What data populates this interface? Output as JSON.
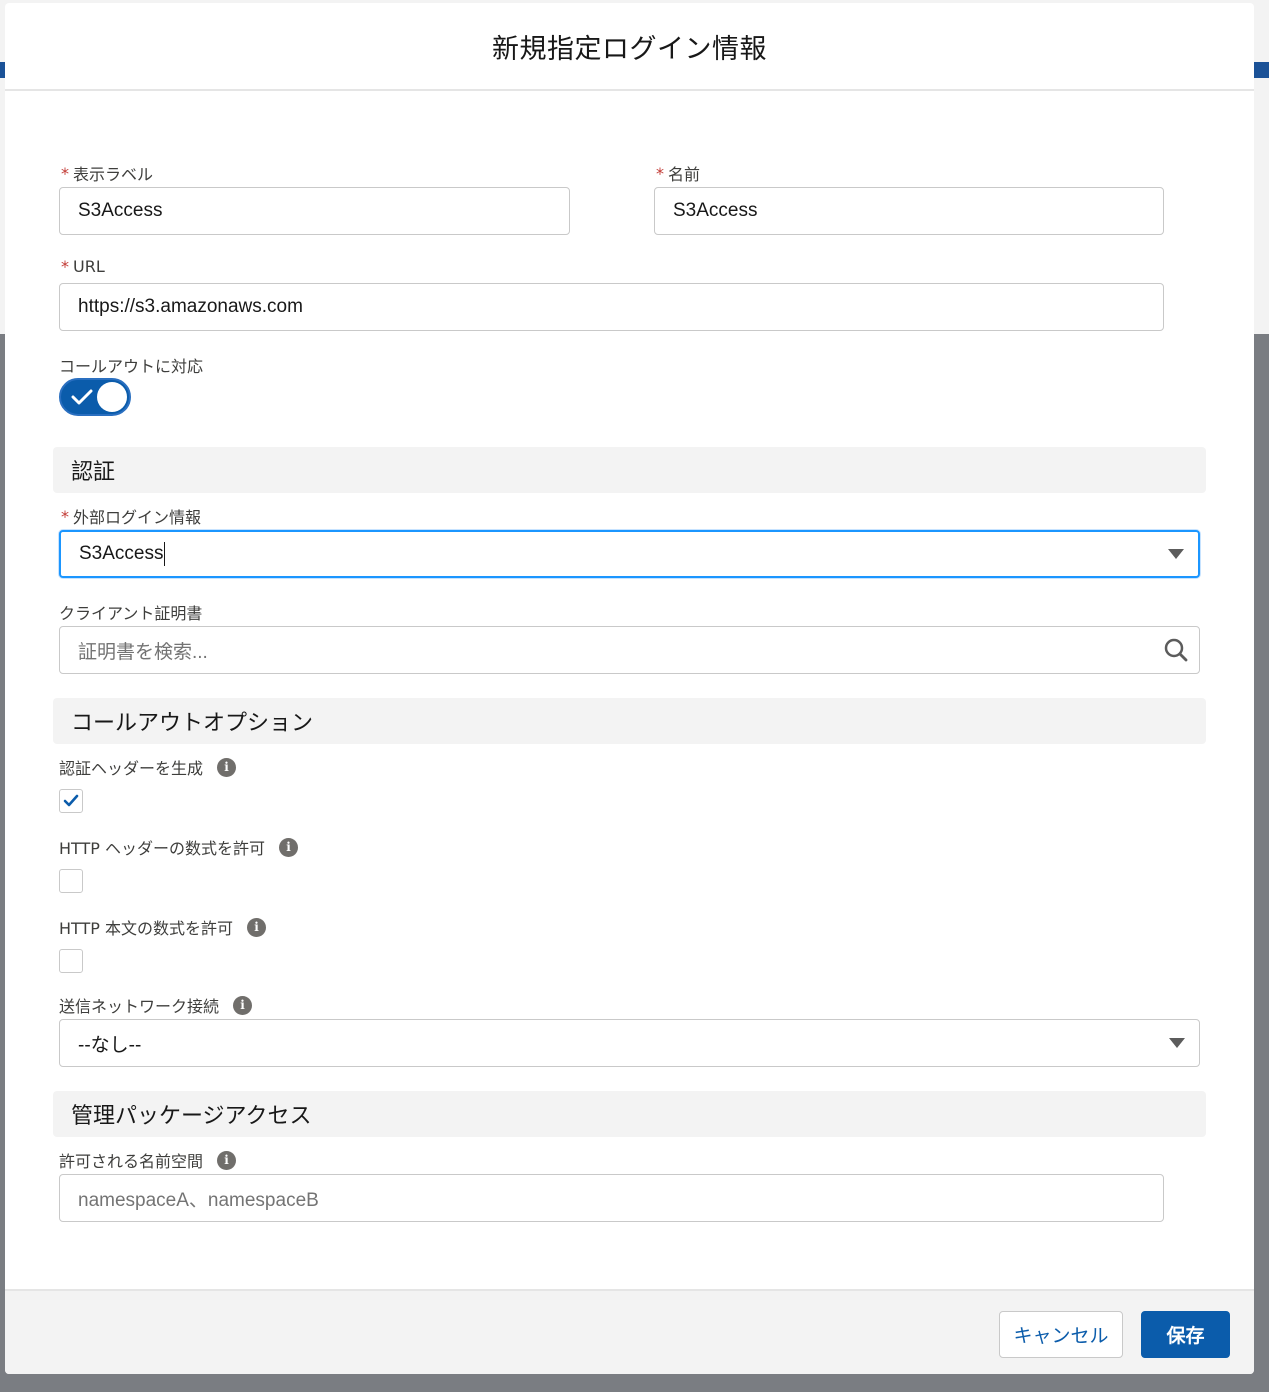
{
  "dialog": {
    "title": "新規指定ログイン情報"
  },
  "fields": {
    "label": {
      "label": "表示ラベル",
      "value": "S3Access",
      "required": true
    },
    "name": {
      "label": "名前",
      "value": "S3Access",
      "required": true
    },
    "url": {
      "label": "URL",
      "value": "https://s3.amazonaws.com",
      "required": true
    },
    "callout": {
      "label": "コールアウトに対応",
      "enabled": true
    }
  },
  "auth_section": {
    "title": "認証",
    "external_credential": {
      "label": "外部ログイン情報",
      "value": "S3Access",
      "required": true
    },
    "client_cert": {
      "label": "クライアント証明書",
      "placeholder": "証明書を検索..."
    }
  },
  "callout_options": {
    "title": "コールアウトオプション",
    "generate_auth_header": {
      "label": "認証ヘッダーを生成",
      "checked": true
    },
    "allow_header_formulas": {
      "label": "HTTP ヘッダーの数式を許可",
      "checked": false
    },
    "allow_body_formulas": {
      "label": "HTTP 本文の数式を許可",
      "checked": false
    },
    "outbound_network": {
      "label": "送信ネットワーク接続",
      "value": "--なし--"
    }
  },
  "managed_package": {
    "title": "管理パッケージアクセス",
    "namespaces": {
      "label": "許可される名前空間",
      "placeholder": "namespaceA、namespaceB"
    }
  },
  "footer": {
    "cancel_label": "キャンセル",
    "save_label": "保存"
  },
  "icons": {
    "info": "info-icon",
    "search": "search-icon",
    "check": "check-icon",
    "dropdown": "chevron-down-icon"
  },
  "colors": {
    "brand": "#0b5cab",
    "required": "#c23934",
    "focus": "#1b96ff"
  }
}
